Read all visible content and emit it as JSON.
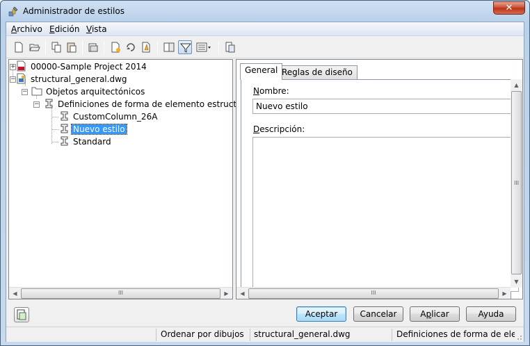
{
  "window": {
    "title": "Administrador de estilos",
    "close_glyph": "✕"
  },
  "menu": [
    {
      "label": "Archivo",
      "key": "A",
      "rest": "rchivo"
    },
    {
      "label": "Edición",
      "key": "E",
      "rest": "dición"
    },
    {
      "label": "Vista",
      "key": "V",
      "rest": "ista"
    }
  ],
  "toolbar": {
    "icons": [
      "new-icon",
      "open-icon",
      "copy-icon",
      "paste-icon",
      "purge-icon",
      "new-style-icon",
      "edit-style-icon",
      "set-from-icon",
      "toggle-view-icon",
      "filter-icon",
      "view-options-icon",
      "inline-edit-icon"
    ],
    "active": "filter-icon"
  },
  "tree": {
    "items": [
      {
        "label": "00000-Sample Project 2014",
        "icon": "project-icon"
      },
      {
        "label": "structural_general.dwg",
        "icon": "drawing-icon"
      },
      {
        "label": "Objetos arquitectónicos",
        "icon": "folder-icon"
      },
      {
        "label": "Definiciones de forma de elemento estructural",
        "icon": "member-shape-icon"
      },
      {
        "label": "CustomColumn_26A",
        "icon": "member-shape-icon"
      },
      {
        "label": "Nuevo estilo",
        "icon": "member-shape-icon",
        "selected": true
      },
      {
        "label": "Standard",
        "icon": "member-shape-icon"
      }
    ]
  },
  "tabs": [
    {
      "label": "General",
      "active": true
    },
    {
      "label": "Reglas de diseño",
      "active": false
    }
  ],
  "form": {
    "name_label_key": "N",
    "name_label_rest": "ombre:",
    "name_value": "Nuevo estilo",
    "desc_label_key": "D",
    "desc_label_rest": "escripción:",
    "desc_value": ""
  },
  "buttons": {
    "ok": "Aceptar",
    "cancel": "Cancelar",
    "apply_key": "p",
    "apply_pre": "A",
    "apply_post": "licar",
    "help": "Ayuda"
  },
  "status": {
    "sort": "Ordenar por dibujos",
    "file": "structural_general.dwg",
    "type": "Definiciones de forma de eleme"
  },
  "scroll_glyphs": {
    "left": "◀",
    "right": "▶",
    "up": "▲",
    "down": "▼",
    "grip": "III"
  }
}
